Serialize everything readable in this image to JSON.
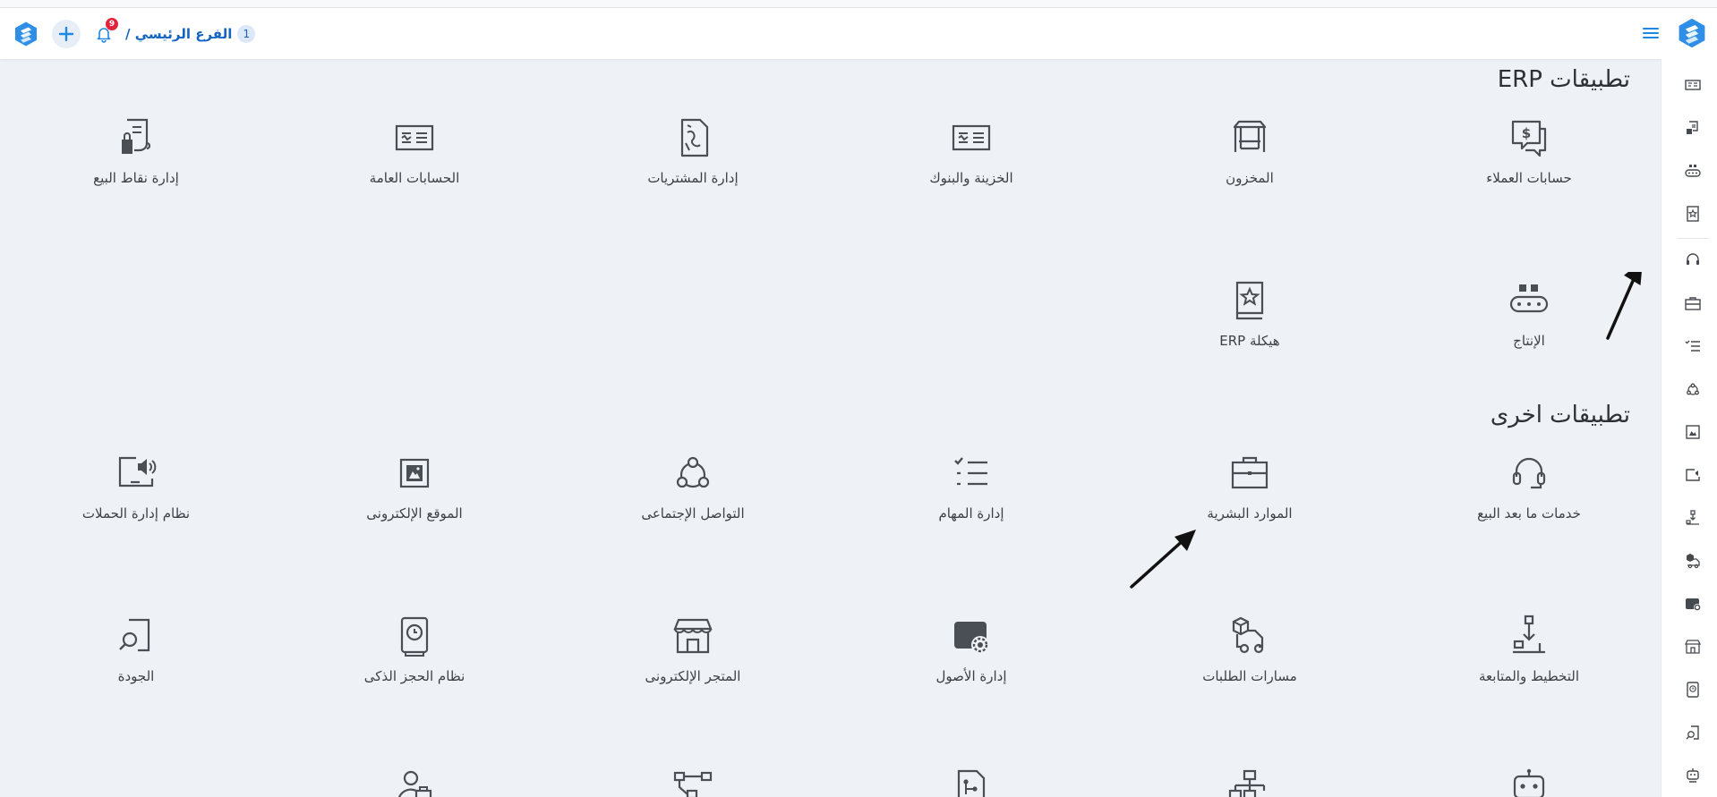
{
  "header": {
    "branch_name": "الفرع الرئيسي /",
    "branch_number": "1",
    "notification_count": "9"
  },
  "sections": [
    {
      "title": "تطبيقات ERP"
    },
    {
      "title": "تطبيقات اخرى"
    }
  ],
  "erp_apps": [
    {
      "label": "حسابات العملاء",
      "icon": "chat-dollar-icon"
    },
    {
      "label": "المخزون",
      "icon": "warehouse-icon"
    },
    {
      "label": "الخزينة والبنوك",
      "icon": "bank-card-icon"
    },
    {
      "label": "إدارة المشتريات",
      "icon": "purchase-doc-icon"
    },
    {
      "label": "الحسابات العامة",
      "icon": "accounts-card-icon"
    },
    {
      "label": "إدارة نقاط البيع",
      "icon": "pos-receipt-icon"
    },
    {
      "label": "الإنتاج",
      "icon": "conveyor-icon"
    },
    {
      "label": "هيكلة ERP",
      "icon": "star-book-icon"
    }
  ],
  "other_apps": [
    {
      "label": "خدمات ما بعد البيع",
      "icon": "headset-icon"
    },
    {
      "label": "الموارد البشرية",
      "icon": "briefcase-icon"
    },
    {
      "label": "إدارة المهام",
      "icon": "checklist-icon"
    },
    {
      "label": "التواصل الإجتماعى",
      "icon": "social-network-icon"
    },
    {
      "label": "الموقع الإلكترونى",
      "icon": "website-icon"
    },
    {
      "label": "نظام إدارة الحملات",
      "icon": "campaign-speaker-icon"
    },
    {
      "label": "التخطيط والمتابعة",
      "icon": "planning-icon"
    },
    {
      "label": "مسارات الطلبات",
      "icon": "delivery-truck-icon"
    },
    {
      "label": "إدارة الأصول",
      "icon": "assets-gear-icon"
    },
    {
      "label": "المتجر الإلكترونى",
      "icon": "store-icon"
    },
    {
      "label": "نظام الحجز الذكى",
      "icon": "booking-clock-icon"
    },
    {
      "label": "الجودة",
      "icon": "quality-search-icon"
    }
  ],
  "colors": {
    "accent": "#1e88e5",
    "badge": "#e0243a",
    "background": "#eef1f5"
  }
}
